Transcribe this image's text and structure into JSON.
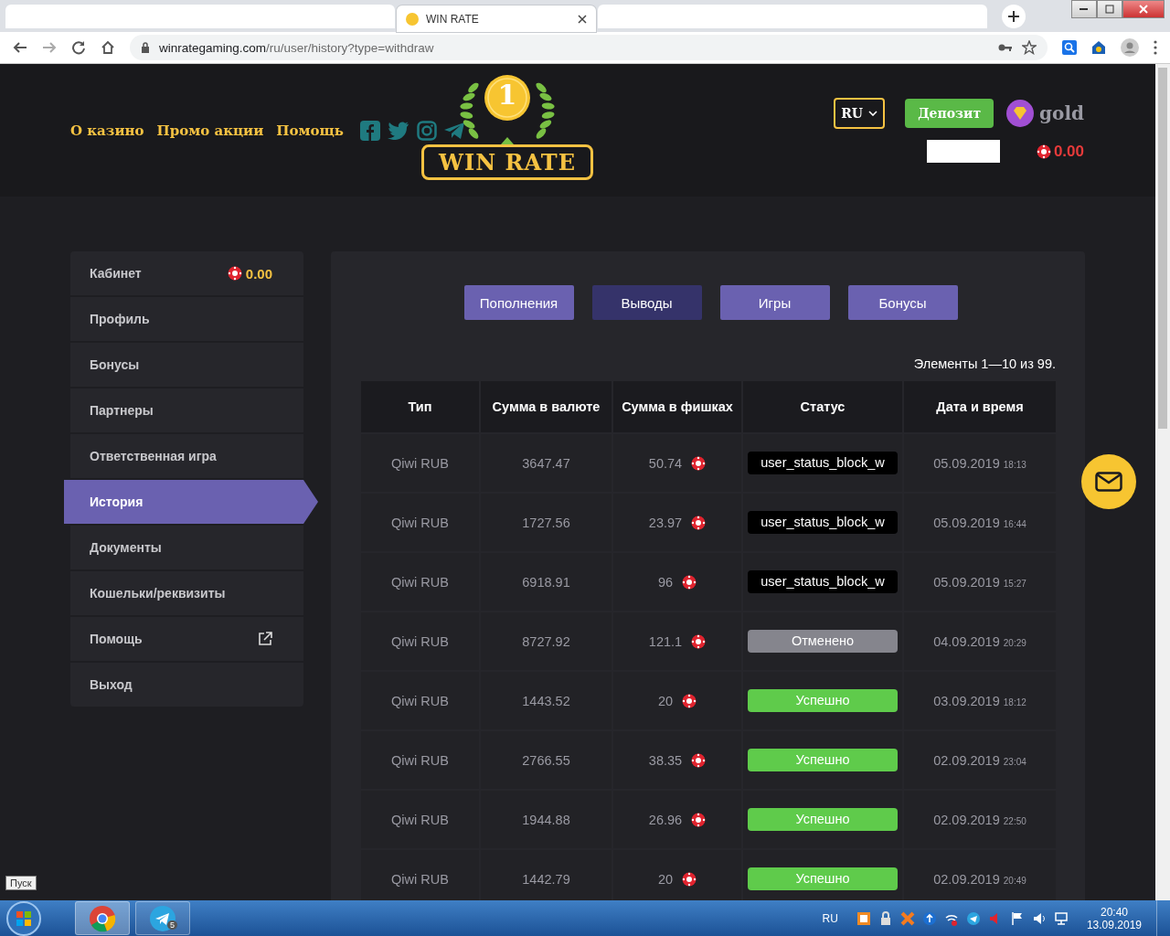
{
  "browser": {
    "tabs": [
      {
        "selected": false
      },
      {
        "title": "WIN RATE",
        "selected": true
      },
      {
        "selected": false
      }
    ],
    "url_host": "winrategaming.com",
    "url_path": "/ru/user/history?type=withdraw"
  },
  "header": {
    "nav": [
      "О казино",
      "Промо акции",
      "Помощь"
    ],
    "logo_number": "1",
    "logo_text": "WIN RATE",
    "language": "RU",
    "deposit_button": "Депозит",
    "level": "gold",
    "balance": "0.00"
  },
  "sidebar": {
    "items": [
      {
        "label": "Кабинет",
        "selected": false,
        "balance": "0.00"
      },
      {
        "label": "Профиль",
        "selected": false
      },
      {
        "label": "Бонусы",
        "selected": false
      },
      {
        "label": "Партнеры",
        "selected": false
      },
      {
        "label": "Ответственная игра",
        "selected": false
      },
      {
        "label": "История",
        "selected": true
      },
      {
        "label": "Документы",
        "selected": false
      },
      {
        "label": "Кошельки/реквизиты",
        "selected": false
      },
      {
        "label": "Помощь",
        "selected": false,
        "external": true
      },
      {
        "label": "Выход",
        "selected": false
      }
    ]
  },
  "history_tabs": [
    {
      "label": "Пополнения",
      "selected": false
    },
    {
      "label": "Выводы",
      "selected": true
    },
    {
      "label": "Игры",
      "selected": false
    },
    {
      "label": "Бонусы",
      "selected": false
    }
  ],
  "pagination_summary": "Элементы 1—10 из 99.",
  "table": {
    "columns": [
      "Тип",
      "Сумма в валюте",
      "Сумма в фишках",
      "Статус",
      "Дата и время"
    ],
    "rows": [
      {
        "type": "Qiwi RUB",
        "amount": "3647.47",
        "chips": "50.74",
        "status": {
          "kind": "blocked",
          "text": "user_status_block_w"
        },
        "date": "05.09.2019",
        "time": "18:13"
      },
      {
        "type": "Qiwi RUB",
        "amount": "1727.56",
        "chips": "23.97",
        "status": {
          "kind": "blocked",
          "text": "user_status_block_w"
        },
        "date": "05.09.2019",
        "time": "16:44"
      },
      {
        "type": "Qiwi RUB",
        "amount": "6918.91",
        "chips": "96",
        "status": {
          "kind": "blocked",
          "text": "user_status_block_w"
        },
        "date": "05.09.2019",
        "time": "15:27"
      },
      {
        "type": "Qiwi RUB",
        "amount": "8727.92",
        "chips": "121.1",
        "status": {
          "kind": "cancelled",
          "text": "Отменено"
        },
        "date": "04.09.2019",
        "time": "20:29"
      },
      {
        "type": "Qiwi RUB",
        "amount": "1443.52",
        "chips": "20",
        "status": {
          "kind": "success",
          "text": "Успешно"
        },
        "date": "03.09.2019",
        "time": "18:12"
      },
      {
        "type": "Qiwi RUB",
        "amount": "2766.55",
        "chips": "38.35",
        "status": {
          "kind": "success",
          "text": "Успешно"
        },
        "date": "02.09.2019",
        "time": "23:04"
      },
      {
        "type": "Qiwi RUB",
        "amount": "1944.88",
        "chips": "26.96",
        "status": {
          "kind": "success",
          "text": "Успешно"
        },
        "date": "02.09.2019",
        "time": "22:50"
      },
      {
        "type": "Qiwi RUB",
        "amount": "1442.79",
        "chips": "20",
        "status": {
          "kind": "success",
          "text": "Успешно"
        },
        "date": "02.09.2019",
        "time": "20:49"
      }
    ]
  },
  "tooltip": "Пуск",
  "taskbar": {
    "telegram_badge": "5",
    "language": "RU",
    "time": "20:40",
    "date": "13.09.2019"
  }
}
